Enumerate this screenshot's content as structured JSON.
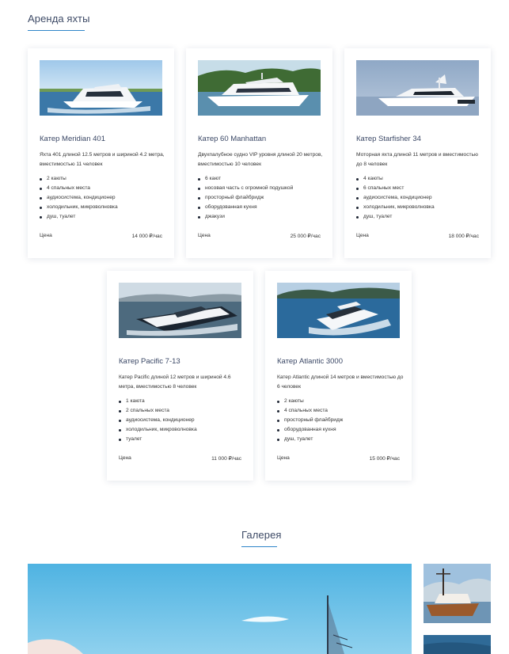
{
  "rental_section": {
    "title": "Аренда яхты"
  },
  "yachts": [
    {
      "name": "Катер Meridian 401",
      "description": "Яхта 401 длиной 12.5 метров и шириной 4.2 метра, вместимостью 11 человек",
      "features": [
        "2 каюты",
        "4 спальных места",
        "аудиосистема, кондиционер",
        "холодильник, микроволновка",
        "душ, туалет"
      ],
      "price_label": "Цена",
      "price": "14 000 ₽/час"
    },
    {
      "name": "Катер 60 Manhattan",
      "description": "Двухпалубное судно VIP уровня длиной 20 метров, вместимостью 10 человек",
      "features": [
        "6 кают",
        "носовая часть с огромной подушкой",
        "просторный флайбридж",
        "оборудованная кухня",
        "джакузи"
      ],
      "price_label": "Цена",
      "price": "25 000 ₽/час"
    },
    {
      "name": "Катер Starfisher 34",
      "description": "Моторная яхта длиной 11 метров и вместимостью до 8 человек",
      "features": [
        "4 каюты",
        "6 спальных мест",
        "аудиосистема, кондиционер",
        "холодильник, микроволновка",
        "душ, туалет"
      ],
      "price_label": "Цена",
      "price": "18 000 ₽/час"
    },
    {
      "name": "Катер Pacific 7-13",
      "description": "Катер Pacific длиной 12 метров и шириной 4.6 метра, вместимостью 8 человек",
      "features": [
        "1 каюта",
        "2 спальных места",
        "аудиосистема, кондиционер",
        "холодильник, микроволновка",
        "туалет"
      ],
      "price_label": "Цена",
      "price": "11 000 ₽/час"
    },
    {
      "name": "Катер Atlantic 3000",
      "description": "Катер Atlantic длиной 14 метров и вместимостью до 6 человек",
      "features": [
        "2 каюты",
        "4 спальных места",
        "просторный флайбридж",
        "оборудованная кухня",
        "душ, туалет"
      ],
      "price_label": "Цена",
      "price": "15 000 ₽/час"
    }
  ],
  "gallery_section": {
    "title": "Галерея"
  },
  "colors": {
    "accent": "#2f86c9",
    "heading": "#3d4a66",
    "text": "#333333"
  }
}
